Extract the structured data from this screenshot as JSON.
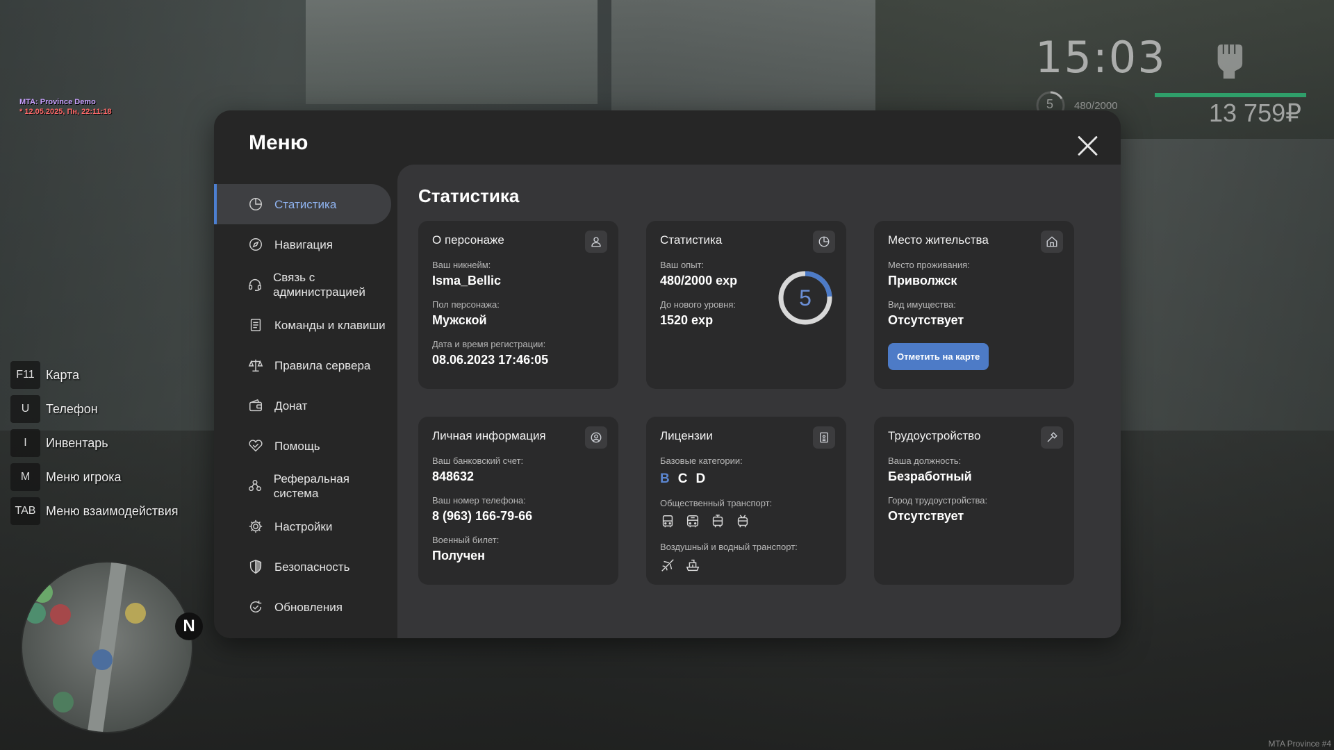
{
  "server": {
    "name": "MTA: Province Demo",
    "datetime": "* 12.05.2025, Пн, 22:11:18"
  },
  "hud": {
    "time": "15:03",
    "level": "5",
    "exp": "480/2000",
    "money": "13 759₽",
    "health_pct": 100
  },
  "hotkeys": [
    {
      "key": "F11",
      "label": "Карта"
    },
    {
      "key": "U",
      "label": "Телефон"
    },
    {
      "key": "I",
      "label": "Инвентарь"
    },
    {
      "key": "M",
      "label": "Меню игрока"
    },
    {
      "key": "TAB",
      "label": "Меню взаимодействия"
    }
  ],
  "minimap": {
    "north": "N"
  },
  "watermark": "MTA Province #4",
  "menu": {
    "title": "Меню",
    "nav": [
      {
        "label": "Статистика",
        "icon": "pie-chart-icon",
        "active": true
      },
      {
        "label": "Навигация",
        "icon": "compass-icon"
      },
      {
        "label": "Связь с администрацией",
        "icon": "headset-icon"
      },
      {
        "label": "Команды и клавиши",
        "icon": "list-icon"
      },
      {
        "label": "Правила сервера",
        "icon": "scales-icon"
      },
      {
        "label": "Донат",
        "icon": "wallet-icon"
      },
      {
        "label": "Помощь",
        "icon": "handshake-icon"
      },
      {
        "label": "Реферальная система",
        "icon": "people-icon"
      },
      {
        "label": "Настройки",
        "icon": "gear-icon"
      },
      {
        "label": "Безопасность",
        "icon": "shield-icon"
      },
      {
        "label": "Обновления",
        "icon": "refresh-check-icon"
      }
    ],
    "section_title": "Статистика",
    "about": {
      "title": "О персонаже",
      "nick_label": "Ваш никнейм:",
      "nick": "Isma_Bellic",
      "gender_label": "Пол персонажа:",
      "gender": "Мужской",
      "reg_label": "Дата и время регистрации:",
      "reg": "08.06.2023 17:46:05"
    },
    "stats": {
      "title": "Статистика",
      "exp_label": "Ваш опыт:",
      "exp": "480/2000 exp",
      "next_label": "До нового уровня:",
      "next": "1520 exp",
      "level": "5",
      "level_progress": 0.24
    },
    "residence": {
      "title": "Место жительства",
      "place_label": "Место проживания:",
      "place": "Приволжск",
      "property_label": "Вид имущества:",
      "property": "Отсутствует",
      "button": "Отметить на карте"
    },
    "personal": {
      "title": "Личная информация",
      "bank_label": "Ваш банковский счет:",
      "bank": "848632",
      "phone_label": "Ваш номер телефона:",
      "phone": "8 (963) 166-79-66",
      "military_label": "Военный билет:",
      "military": "Получен"
    },
    "licenses": {
      "title": "Лицензии",
      "base_label": "Базовые категории:",
      "categories": [
        {
          "name": "B",
          "active": true
        },
        {
          "name": "C"
        },
        {
          "name": "D"
        }
      ],
      "public_label": "Общественный транспорт:",
      "air_label": "Воздушный и водный транспорт:"
    },
    "job": {
      "title": "Трудоустройство",
      "position_label": "Ваша должность:",
      "position": "Безработный",
      "city_label": "Город трудоустройства:",
      "city": "Отсутствует"
    },
    "colors": {
      "accent": "#4c7fd0",
      "panel": "#262626",
      "content": "#363638",
      "card": "#2a2a2b"
    }
  }
}
